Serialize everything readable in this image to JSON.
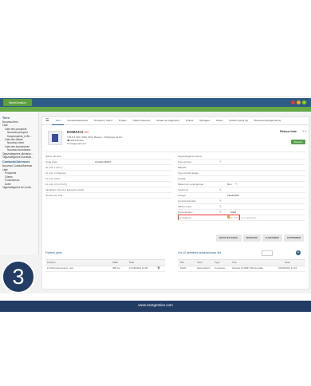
{
  "app": {
    "logo_text": "NextGestion",
    "window_dot_colors": [
      "#e53935",
      "#f5a623",
      "#7ed321"
    ]
  },
  "sidebar": {
    "items": [
      {
        "label": "Tiers",
        "level": "head"
      },
      {
        "label": "Nouveau tiers",
        "level": "0"
      },
      {
        "label": "Liste",
        "level": "0"
      },
      {
        "label": "Liste des prospects",
        "level": "1"
      },
      {
        "label": "Nouveau prospect",
        "level": "2"
      },
      {
        "label": "Kanprospects_LeNi...",
        "level": "2"
      },
      {
        "label": "Liste des clients",
        "level": "1"
      },
      {
        "label": "Nouveau client",
        "level": "2"
      },
      {
        "label": "Liste des fournisseurs",
        "level": "1"
      },
      {
        "label": "Nouveau fournisseur",
        "level": "2"
      },
      {
        "label": "Tags/catégories clients/pr...",
        "level": "0"
      },
      {
        "label": "Tags/catégories fournisse...",
        "level": "0"
      },
      {
        "label": "Contacts/Adresses",
        "level": "head"
      },
      {
        "label": "Nouveau Contact/Adresse",
        "level": "0"
      },
      {
        "label": "Liste",
        "level": "0"
      },
      {
        "label": "Prospects",
        "level": "1"
      },
      {
        "label": "Clients",
        "level": "1"
      },
      {
        "label": "Fournisseurs",
        "level": "1"
      },
      {
        "label": "Autre",
        "level": "1"
      },
      {
        "label": "Tags/catégories de conta...",
        "level": "0"
      }
    ]
  },
  "tabs": [
    "Tiers",
    "Contacts/Adresses",
    "Prospect | Client",
    "Projets",
    "Objets référents",
    "Modes de règlement",
    "Tickets",
    "Ménages",
    "Notes",
    "Fichiers joints (0)",
    "Événements/Agenda (0)"
  ],
  "company": {
    "name": "DOMACO",
    "address": "B.P.3, 300, 5000 CP.8, Maseru - Préfecture de Ifni",
    "phone": "0612111122",
    "email": "fwr@gmail.com"
  },
  "header": {
    "back_label": "Retour liste",
    "prev_icon": "chevron-left-icon",
    "next_icon": "chevron-right-icon",
    "green_button": "Devenir"
  },
  "left_fields": [
    {
      "label": "Nature du tiers",
      "value": ""
    },
    {
      "label": "Code client",
      "value": "CU2211-00097"
    },
    {
      "label": "Id. prof. 1 (R.C.)",
      "value": ""
    },
    {
      "label": "Id. prof. 2 (Patente)",
      "value": ""
    },
    {
      "label": "Id. prof. 3 (IF.)",
      "value": ""
    },
    {
      "label": "Id. prof. 4 (C.N.S.S.)",
      "value": ""
    },
    {
      "label": "Identifiant Commun Entreprise (ICE)",
      "value": ""
    },
    {
      "label": "Numéro de TVA",
      "value": ""
    }
  ],
  "right_fields": [
    {
      "label": "Tags/catégories clients",
      "value": ""
    },
    {
      "label": "Type du tiers",
      "value": ""
    },
    {
      "label": "Effectifs",
      "value": ""
    },
    {
      "label": "Type d'entité légale",
      "value": ""
    },
    {
      "label": "Capital",
      "value": ""
    },
    {
      "label": "Maison de vente/groupe",
      "value": "Non"
    },
    {
      "label": "Incoterms",
      "value": ""
    },
    {
      "label": "Langue",
      "value": "16/11/2022"
    },
    {
      "label": "Compte bancaire",
      "value": ""
    },
    {
      "label": "Maison mère",
      "value": ""
    },
    {
      "label": "Commerciaux",
      "value": "Utilisi"
    },
    {
      "label": "Lien externe",
      "value": "Tiers non lié à un utilisateur"
    }
  ],
  "actions": [
    "ENVOYER EMAIL",
    "MODIFIER",
    "FUSIONNER",
    "SUPPRIMER"
  ],
  "files": {
    "title": "Fichiers joints",
    "headers": [
      "Fichiers",
      "Taille",
      "Date",
      ""
    ],
    "rows": [
      {
        "name": "Ordonnancement...doc",
        "size": "358 Ko",
        "date": "17/08/2021 12:55"
      }
    ]
  },
  "invoices": {
    "title": "Les 10 dernières factures/avoirs liés",
    "headers": [
      "Réf.",
      "Tiers",
      "Type",
      "Titre",
      "Date"
    ],
    "rows": [
      {
        "ref": "FA18",
        "tiers": "SuperAdmin",
        "type": "Composa...",
        "title": "Facture 174(897-0614-sudde",
        "date": "01/06/2021 17:21"
      }
    ]
  },
  "footer": {
    "url": "www.nextgestion.com"
  },
  "step_number": "3"
}
